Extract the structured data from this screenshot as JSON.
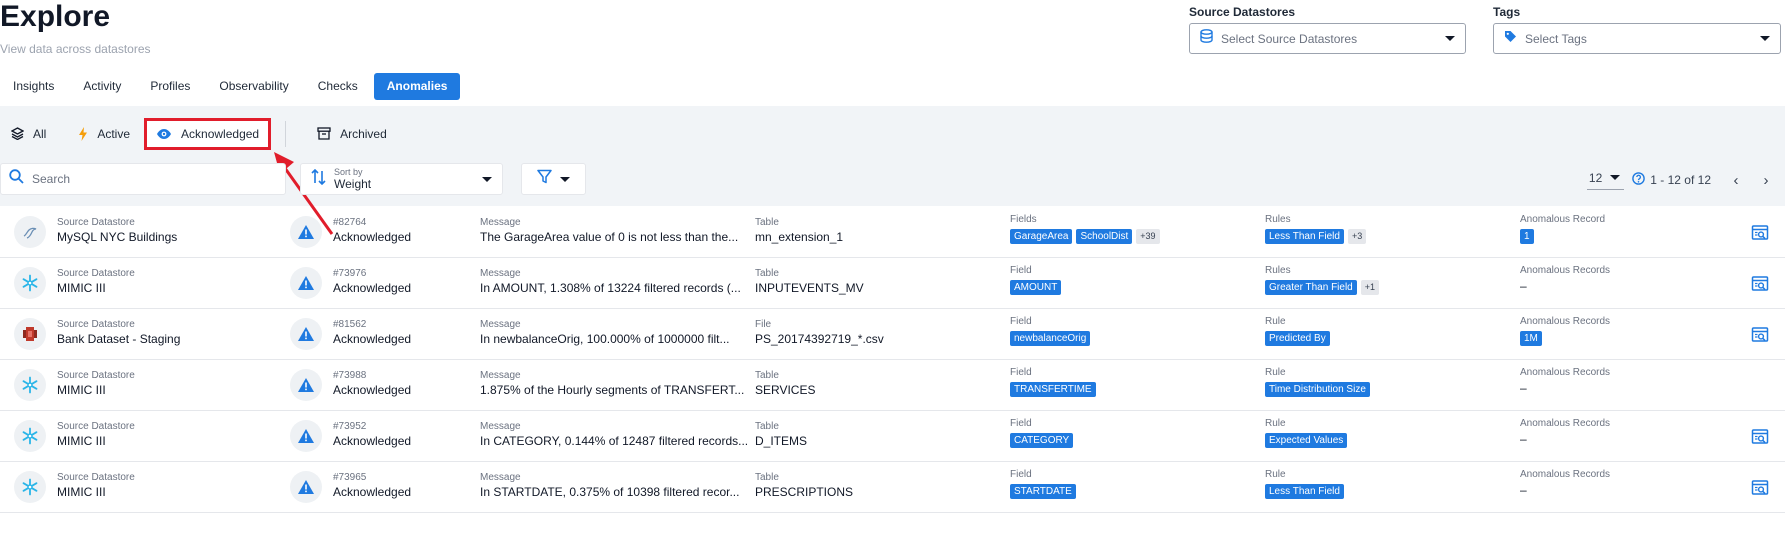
{
  "header": {
    "title": "Explore",
    "subtitle": "View data across datastores"
  },
  "filters": {
    "source": {
      "label": "Source Datastores",
      "placeholder": "Select Source Datastores"
    },
    "tags": {
      "label": "Tags",
      "placeholder": "Select Tags"
    }
  },
  "tabs": [
    {
      "label": "Insights"
    },
    {
      "label": "Activity"
    },
    {
      "label": "Profiles"
    },
    {
      "label": "Observability"
    },
    {
      "label": "Checks"
    },
    {
      "label": "Anomalies",
      "active": true
    }
  ],
  "status_filter": {
    "all": "All",
    "active": "Active",
    "acknowledged": "Acknowledged",
    "archived": "Archived"
  },
  "toolbar": {
    "search_placeholder": "Search",
    "sort_label": "Sort by",
    "sort_value": "Weight"
  },
  "pagination": {
    "page_size": "12",
    "range": "1 - 12 of 12"
  },
  "columns": {
    "datastore": "Source Datastore",
    "message": "Message"
  },
  "rows": [
    {
      "datastore_label": "Source Datastore",
      "datastore": "MySQL NYC Buildings",
      "ds_type": "mysql",
      "id": "#82764",
      "status": "Acknowledged",
      "message_label": "Message",
      "message": "The GarageArea value of 0 is not less than the...",
      "container_label": "Table",
      "container": "mn_extension_1",
      "fields_label": "Fields",
      "fields": [
        "GarageArea",
        "SchoolDist"
      ],
      "fields_more": "+39",
      "rules_label": "Rules",
      "rules": [
        "Less Than Field"
      ],
      "rules_more": "+3",
      "records_label": "Anomalous Record",
      "records": "1",
      "records_is_tag": true,
      "inspect": true
    },
    {
      "datastore_label": "Source Datastore",
      "datastore": "MIMIC III",
      "ds_type": "snowflake",
      "id": "#73976",
      "status": "Acknowledged",
      "message_label": "Message",
      "message": "In AMOUNT, 1.308% of 13224 filtered records (...",
      "container_label": "Table",
      "container": "INPUTEVENTS_MV",
      "fields_label": "Field",
      "fields": [
        "AMOUNT"
      ],
      "fields_more": "",
      "rules_label": "Rules",
      "rules": [
        "Greater Than Field"
      ],
      "rules_more": "+1",
      "records_label": "Anomalous Records",
      "records": "–",
      "records_is_tag": false,
      "inspect": true
    },
    {
      "datastore_label": "Source Datastore",
      "datastore": "Bank Dataset - Staging",
      "ds_type": "bank",
      "id": "#81562",
      "status": "Acknowledged",
      "message_label": "Message",
      "message": "In newbalanceOrig, 100.000% of 1000000 filt...",
      "container_label": "File",
      "container": "PS_20174392719_*.csv",
      "fields_label": "Field",
      "fields": [
        "newbalanceOrig"
      ],
      "fields_more": "",
      "rules_label": "Rule",
      "rules": [
        "Predicted By"
      ],
      "rules_more": "",
      "records_label": "Anomalous Records",
      "records": "1M",
      "records_is_tag": true,
      "inspect": true
    },
    {
      "datastore_label": "Source Datastore",
      "datastore": "MIMIC III",
      "ds_type": "snowflake",
      "id": "#73988",
      "status": "Acknowledged",
      "message_label": "Message",
      "message": "1.875% of the Hourly segments of TRANSFERT...",
      "container_label": "Table",
      "container": "SERVICES",
      "fields_label": "Field",
      "fields": [
        "TRANSFERTIME"
      ],
      "fields_more": "",
      "rules_label": "Rule",
      "rules": [
        "Time Distribution Size"
      ],
      "rules_more": "",
      "records_label": "Anomalous Records",
      "records": "–",
      "records_is_tag": false,
      "inspect": false
    },
    {
      "datastore_label": "Source Datastore",
      "datastore": "MIMIC III",
      "ds_type": "snowflake",
      "id": "#73952",
      "status": "Acknowledged",
      "message_label": "Message",
      "message": "In CATEGORY, 0.144% of 12487 filtered records...",
      "container_label": "Table",
      "container": "D_ITEMS",
      "fields_label": "Field",
      "fields": [
        "CATEGORY"
      ],
      "fields_more": "",
      "rules_label": "Rule",
      "rules": [
        "Expected Values"
      ],
      "rules_more": "",
      "records_label": "Anomalous Records",
      "records": "–",
      "records_is_tag": false,
      "inspect": true
    },
    {
      "datastore_label": "Source Datastore",
      "datastore": "MIMIC III",
      "ds_type": "snowflake",
      "id": "#73965",
      "status": "Acknowledged",
      "message_label": "Message",
      "message": "In STARTDATE, 0.375% of 10398 filtered recor...",
      "container_label": "Table",
      "container": "PRESCRIPTIONS",
      "fields_label": "Field",
      "fields": [
        "STARTDATE"
      ],
      "fields_more": "",
      "rules_label": "Rule",
      "rules": [
        "Less Than Field"
      ],
      "rules_more": "",
      "records_label": "Anomalous Records",
      "records": "–",
      "records_is_tag": false,
      "inspect": true
    }
  ],
  "colors": {
    "accent": "#1f7ae0",
    "highlight": "#e11d2b",
    "warning": "#1f7ae0",
    "bolt": "#f59e0b"
  }
}
